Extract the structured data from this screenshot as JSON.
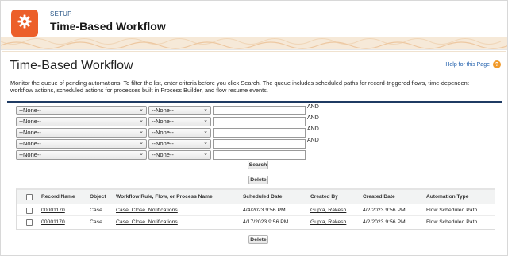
{
  "header": {
    "setup_label": "SETUP",
    "title": "Time-Based Workflow",
    "icon": "gear-icon",
    "accent_color": "#ec5f29"
  },
  "page": {
    "title": "Time-Based Workflow",
    "help_link": "Help for this Page",
    "help_icon": "question-icon",
    "description": "Monitor the queue of pending automations. To filter the list, enter criteria before you click Search. The queue includes scheduled paths for record-triggered flows, time-dependent workflow actions, scheduled actions for processes built in Process Builder, and flow resume events."
  },
  "criteria": {
    "rows": [
      {
        "field": "--None--",
        "operator": "--None--",
        "value": "",
        "connector": "AND"
      },
      {
        "field": "--None--",
        "operator": "--None--",
        "value": "",
        "connector": "AND"
      },
      {
        "field": "--None--",
        "operator": "--None--",
        "value": "",
        "connector": "AND"
      },
      {
        "field": "--None--",
        "operator": "--None--",
        "value": "",
        "connector": "AND"
      },
      {
        "field": "--None--",
        "operator": "--None--",
        "value": "",
        "connector": ""
      }
    ],
    "search_label": "Search",
    "delete_label": "Delete"
  },
  "table": {
    "columns": [
      "Record Name",
      "Object",
      "Workflow Rule, Flow, or Process Name",
      "Scheduled Date",
      "Created By",
      "Created Date",
      "Automation Type"
    ],
    "rows": [
      {
        "record_name": "00001170",
        "object": "Case",
        "name": "Case_Close_Notifications",
        "scheduled_date": "4/4/2023 9:56 PM",
        "created_by": "Gupta, Rakesh",
        "created_date": "4/2/2023 9:56 PM",
        "automation_type": "Flow Scheduled Path"
      },
      {
        "record_name": "00001170",
        "object": "Case",
        "name": "Case_Close_Notifications",
        "scheduled_date": "4/17/2023 9:56 PM",
        "created_by": "Gupta, Rakesh",
        "created_date": "4/2/2023 9:56 PM",
        "automation_type": "Flow Scheduled Path"
      }
    ],
    "delete_label": "Delete"
  }
}
